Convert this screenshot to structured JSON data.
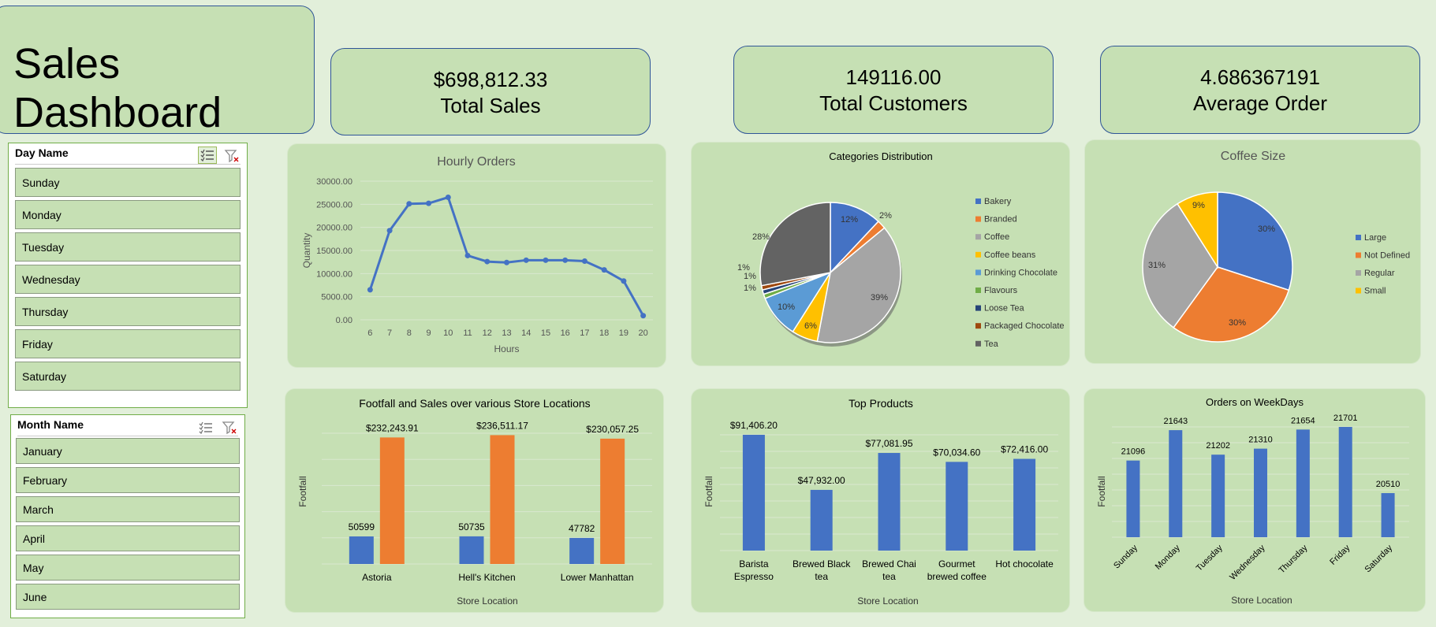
{
  "header": {
    "title": "Sales Dashboard"
  },
  "kpis": [
    {
      "value": "$698,812.33",
      "label": "Total Sales"
    },
    {
      "value": "149116.00",
      "label": "Total Customers"
    },
    {
      "value": "4.686367191",
      "label": "Average Order"
    }
  ],
  "slicers": {
    "day": {
      "title": "Day Name",
      "items": [
        "Sunday",
        "Monday",
        "Tuesday",
        "Wednesday",
        "Thursday",
        "Friday",
        "Saturday"
      ]
    },
    "month": {
      "title": "Month Name",
      "items": [
        "January",
        "February",
        "March",
        "April",
        "May",
        "June"
      ]
    }
  },
  "colors": {
    "blue": "#4472c4",
    "orange": "#ed7d31",
    "gray": "#a5a5a5",
    "yellow": "#ffc000",
    "lightblue": "#5b9bd5",
    "green": "#70ad47",
    "navy": "#264478",
    "brown": "#9e480e",
    "darkgray": "#636363",
    "panel": "#c6e0b4"
  },
  "chart_data": [
    {
      "type": "line",
      "title": "Hourly Orders",
      "xlabel": "Hours",
      "ylabel": "Quantity",
      "x": [
        6,
        7,
        8,
        9,
        10,
        11,
        12,
        13,
        14,
        15,
        16,
        17,
        18,
        19,
        20
      ],
      "values": [
        6500,
        19300,
        25100,
        25200,
        26500,
        13900,
        12600,
        12400,
        12900,
        12900,
        12900,
        12700,
        10800,
        8400,
        900
      ],
      "ylim": [
        0,
        30000
      ],
      "yticks": [
        "0.00",
        "5000.00",
        "10000.00",
        "15000.00",
        "20000.00",
        "25000.00",
        "30000.00"
      ],
      "grid": true
    },
    {
      "type": "pie",
      "title": "Categories Distribution",
      "legend": "right",
      "labels": [
        "Bakery",
        "Branded",
        "Coffee",
        "Coffee beans",
        "Drinking Chocolate",
        "Flavours",
        "Loose Tea",
        "Packaged Chocolate",
        "Tea"
      ],
      "values": [
        12,
        2,
        39,
        6,
        10,
        1,
        1,
        1,
        28
      ],
      "data_labels": [
        "12%",
        "2%",
        "39%",
        "6%",
        "10%",
        "1%",
        "1%",
        "1%",
        "28%"
      ]
    },
    {
      "type": "pie",
      "title": "Coffee Size",
      "legend": "right",
      "labels": [
        "Large",
        "Not Defined",
        "Regular",
        "Small"
      ],
      "values": [
        30,
        30,
        31,
        9
      ],
      "data_labels": [
        "30%",
        "30%",
        "31%",
        "9%"
      ]
    },
    {
      "type": "bar",
      "title": "Footfall and Sales over various Store Locations",
      "xlabel": "Store Location",
      "ylabel": "Footfall",
      "categories": [
        "Astoria",
        "Hell's Kitchen",
        "Lower Manhattan"
      ],
      "series": [
        {
          "values": [
            50599,
            50735,
            47782
          ],
          "labels": [
            "50599",
            "50735",
            "47782"
          ]
        },
        {
          "values": [
            232243.91,
            236511.17,
            230057.25
          ],
          "labels": [
            "$232,243.91",
            "$236,511.17",
            "$230,057.25"
          ]
        }
      ]
    },
    {
      "type": "bar",
      "title": "Top Products",
      "xlabel": "Store Location",
      "ylabel": "Footfall",
      "categories": [
        [
          "Barista",
          "Espresso"
        ],
        [
          "Brewed Black",
          "tea"
        ],
        [
          "Brewed Chai",
          "tea"
        ],
        [
          "Gourmet",
          "brewed coffee"
        ],
        [
          "Hot chocolate"
        ]
      ],
      "values": [
        91406.2,
        47932.0,
        77081.95,
        70034.6,
        72416.0
      ],
      "labels": [
        "$91,406.20",
        "$47,932.00",
        "$77,081.95",
        "$70,034.60",
        "$72,416.00"
      ]
    },
    {
      "type": "bar",
      "title": "Orders on WeekDays",
      "xlabel": "Store Location",
      "ylabel": "Footfall",
      "categories": [
        "Sunday",
        "Monday",
        "Tuesday",
        "Wednesday",
        "Thursday",
        "Friday",
        "Saturday"
      ],
      "values": [
        21096,
        21643,
        21202,
        21310,
        21654,
        21701,
        20510
      ],
      "labels": [
        "21096",
        "21643",
        "21202",
        "21310",
        "21654",
        "21701",
        "20510"
      ]
    }
  ]
}
